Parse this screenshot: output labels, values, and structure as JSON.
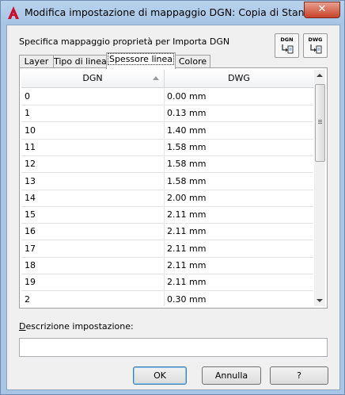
{
  "window": {
    "title": "Modifica impostazione di mappaggio DGN: Copia di Standard",
    "close_glyph": "✕"
  },
  "header": {
    "subtitle": "Specifica mappaggio proprietà per Importa DGN",
    "btn_dgn_label": "DGN",
    "btn_dwg_label": "DWG"
  },
  "tabs": [
    {
      "label": "Layer",
      "active": false
    },
    {
      "label": "Tipo di linea",
      "active": false
    },
    {
      "label": "Spessore linea",
      "active": true
    },
    {
      "label": "Colore",
      "active": false
    }
  ],
  "table": {
    "columns": [
      "DGN",
      "DWG"
    ],
    "sort_column": "DGN",
    "rows": [
      {
        "dgn": "0",
        "dwg": "0.00 mm"
      },
      {
        "dgn": "1",
        "dwg": "0.13 mm"
      },
      {
        "dgn": "10",
        "dwg": "1.40 mm"
      },
      {
        "dgn": "11",
        "dwg": "1.58 mm"
      },
      {
        "dgn": "12",
        "dwg": "1.58 mm"
      },
      {
        "dgn": "13",
        "dwg": "1.58 mm"
      },
      {
        "dgn": "14",
        "dwg": "2.00 mm"
      },
      {
        "dgn": "15",
        "dwg": "2.11 mm"
      },
      {
        "dgn": "16",
        "dwg": "2.11 mm"
      },
      {
        "dgn": "17",
        "dwg": "2.11 mm"
      },
      {
        "dgn": "18",
        "dwg": "2.11 mm"
      },
      {
        "dgn": "19",
        "dwg": "2.11 mm"
      },
      {
        "dgn": "2",
        "dwg": "0.30 mm"
      }
    ]
  },
  "description": {
    "label_prefix": "D",
    "label_rest": "escrizione impostazione:",
    "value": ""
  },
  "buttons": {
    "ok": "OK",
    "cancel": "Annulla",
    "help": "?"
  },
  "colors": {
    "accent_app_icon": "#c8102e",
    "titlebar": "#a8c5e5",
    "close_button": "#c7432a"
  },
  "icons": [
    "autocad-app-icon",
    "close-icon",
    "dgn-import-icon",
    "dwg-import-icon",
    "sort-ascending-icon",
    "scroll-up-icon",
    "scroll-down-icon"
  ]
}
